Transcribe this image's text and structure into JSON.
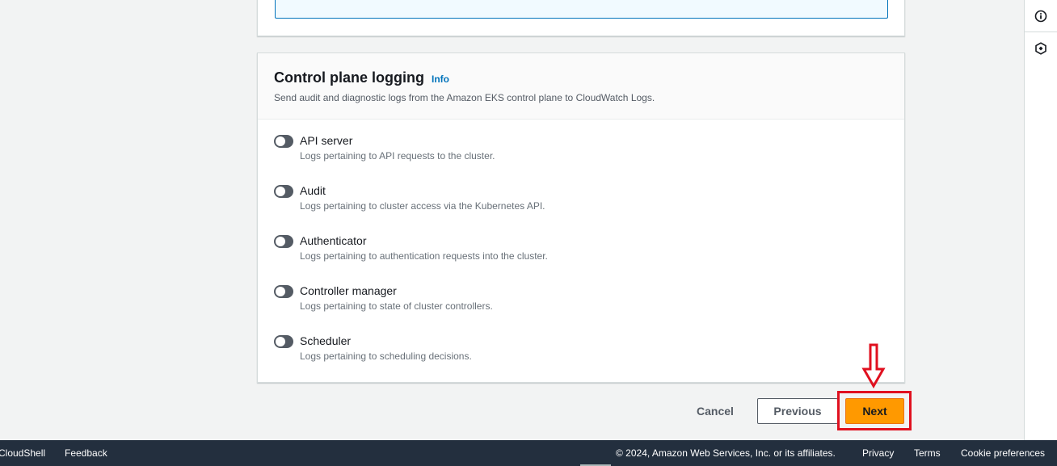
{
  "colors": {
    "accent_orange": "#ff9900",
    "link_blue": "#0073bb",
    "footer_bg": "#232f3e",
    "annotation_red": "#e0101f",
    "toggle_off": "#545b64"
  },
  "right_rail": {
    "info_icon": "info-circle-icon",
    "hex_icon": "hexagon-settings-icon"
  },
  "logging": {
    "title": "Control plane logging",
    "info_link": "Info",
    "description": "Send audit and diagnostic logs from the Amazon EKS control plane to CloudWatch Logs.",
    "items": [
      {
        "label": "API server",
        "description": "Logs pertaining to API requests to the cluster.",
        "enabled": false
      },
      {
        "label": "Audit",
        "description": "Logs pertaining to cluster access via the Kubernetes API.",
        "enabled": false
      },
      {
        "label": "Authenticator",
        "description": "Logs pertaining to authentication requests into the cluster.",
        "enabled": false
      },
      {
        "label": "Controller manager",
        "description": "Logs pertaining to state of cluster controllers.",
        "enabled": false
      },
      {
        "label": "Scheduler",
        "description": "Logs pertaining to scheduling decisions.",
        "enabled": false
      }
    ]
  },
  "actions": {
    "cancel": "Cancel",
    "previous": "Previous",
    "next": "Next"
  },
  "footer": {
    "cloudshell": "CloudShell",
    "feedback": "Feedback",
    "copyright": "© 2024, Amazon Web Services, Inc. or its affiliates.",
    "privacy": "Privacy",
    "terms": "Terms",
    "cookie_preferences": "Cookie preferences"
  }
}
